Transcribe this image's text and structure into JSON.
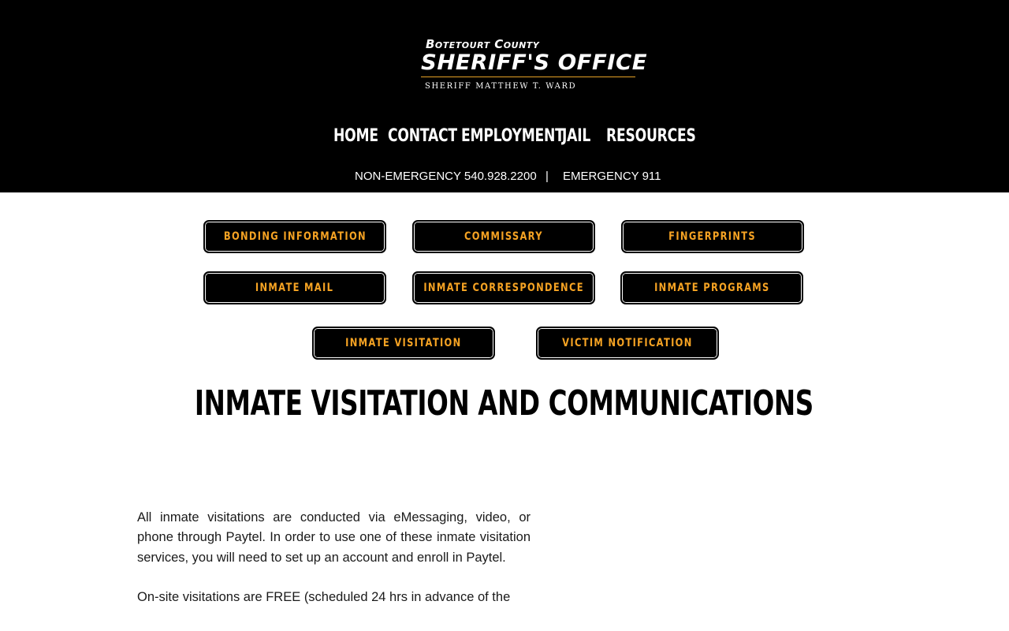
{
  "logo": {
    "county": "Botetourt County",
    "office": "SHERIFF'S OFFICE",
    "sheriff": "SHERIFF MATTHEW T. WARD"
  },
  "nav": {
    "home": "HOME",
    "contact": "CONTACT",
    "employment": "EMPLOYMENT",
    "jail": "JAIL",
    "resources": "RESOURCES"
  },
  "phones": {
    "non_emergency": "NON-EMERGENCY 540.928.2200",
    "separator": "|",
    "emergency": "EMERGENCY 911"
  },
  "buttons": [
    "BONDING INFORMATION",
    "COMMISSARY",
    "FINGERPRINTS",
    "INMATE MAIL",
    "INMATE CORRESPONDENCE",
    "INMATE PROGRAMS",
    "INMATE VISITATION",
    "VICTIM NOTIFICATION"
  ],
  "page": {
    "title": "INMATE VISITATION AND COMMUNICATIONS",
    "paragraphs": [
      "All inmate visitations are conducted via eMessaging, video, or phone through Paytel. In order to use one of these inmate visitation services, you will need to set up an account and enroll in Paytel.",
      "On-site visitations are FREE (scheduled 24 hrs in advance of the"
    ]
  },
  "colors": {
    "header_bg": "#000000",
    "button_text": "#f6a323",
    "logo_rule": "#e6a126"
  }
}
